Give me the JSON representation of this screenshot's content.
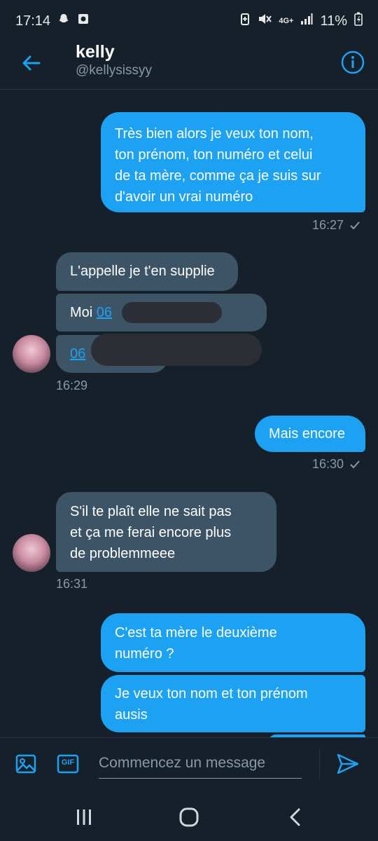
{
  "status_bar": {
    "time": "17:14",
    "network": "4G+",
    "battery": "11%",
    "icons": [
      "snapchat-icon",
      "app-icon",
      "battery-saver-icon",
      "mute-icon",
      "signal-icon",
      "battery-icon"
    ]
  },
  "header": {
    "name": "kelly",
    "handle": "@kellysissyy",
    "back_icon": "arrow-left-icon",
    "info_icon": "info-icon"
  },
  "colors": {
    "background": "#15202b",
    "accent": "#1da1f2",
    "incoming_bubble": "#3d5466",
    "muted_text": "#8899a6"
  },
  "messages": [
    {
      "direction": "out",
      "lines": [
        "Très bien alors je veux ton nom,",
        "ton prénom,  ton numéro et celui",
        "de ta mère,  comme ça je suis sur",
        "d'avoir un vrai numéro"
      ],
      "time": "16:27"
    },
    {
      "direction": "in",
      "text": "L'appelle je t'en supplie"
    },
    {
      "direction": "in",
      "prefix": "Moi ",
      "link": "06"
    },
    {
      "direction": "in",
      "link": "06",
      "time": "16:29"
    },
    {
      "direction": "out",
      "text": "Mais encore",
      "time": "16:30"
    },
    {
      "direction": "in",
      "lines": [
        "S'il te plaît elle ne sait pas",
        "et ça me ferai encore plus",
        "de problemmeee"
      ],
      "time": "16:31"
    },
    {
      "direction": "out",
      "lines": [
        "C'est ta mère le deuxième",
        "numéro ?"
      ]
    },
    {
      "direction": "out",
      "lines": [
        "Je veux ton nom et ton prénom",
        "ausis"
      ]
    }
  ],
  "composer": {
    "placeholder": "Commencez un message",
    "gif_label": "GIF",
    "image_icon": "image-icon",
    "send_icon": "send-icon"
  },
  "nav": {
    "icons": [
      "recents-icon",
      "home-icon",
      "back-icon"
    ]
  }
}
